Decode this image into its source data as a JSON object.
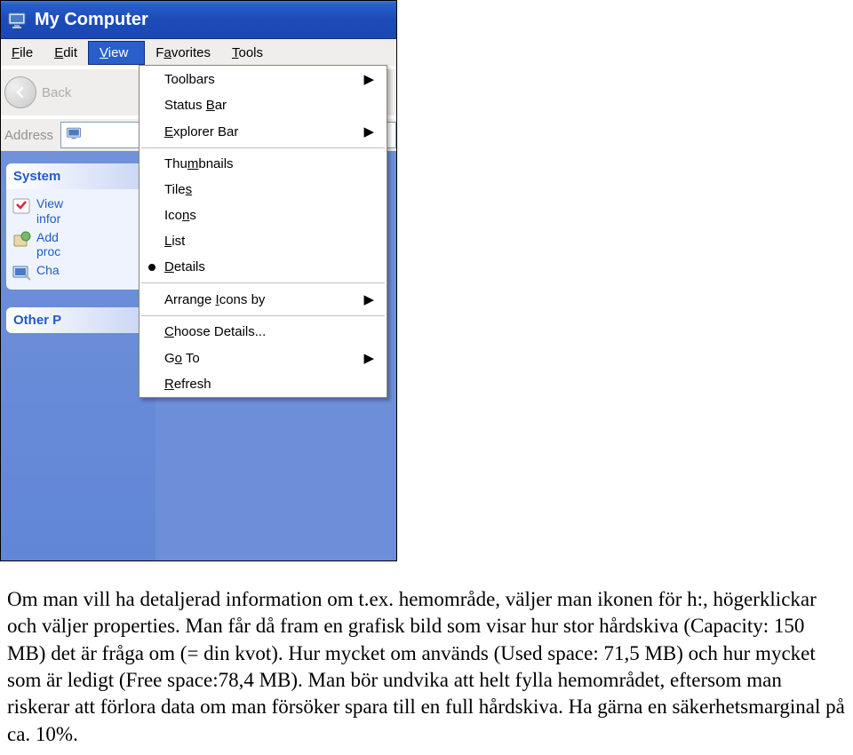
{
  "window": {
    "title": "My Computer"
  },
  "menubar": {
    "file": "File",
    "edit": "Edit",
    "view": "View",
    "favorites": "Favorites",
    "tools": "Tools"
  },
  "toolbar": {
    "back": "Back"
  },
  "address": {
    "label": "Address"
  },
  "sidebar": {
    "system_head": "System",
    "tasks": {
      "view_info": "View\ninfor",
      "add_prog": "Add\nproc",
      "change": "Cha"
    },
    "other_head": "Other P"
  },
  "dropdown": {
    "toolbars": "Toolbars",
    "status_bar_pre": "Status ",
    "status_bar_ul": "B",
    "status_bar_post": "ar",
    "explorer_pre": "",
    "explorer_ul": "E",
    "explorer_post": "xplorer Bar",
    "thumbnails_pre": "Thu",
    "thumbnails_ul": "m",
    "thumbnails_post": "bnails",
    "tiles_pre": "Tile",
    "tiles_ul": "s",
    "tiles_post": "",
    "icons_pre": "Ico",
    "icons_ul": "n",
    "icons_post": "s",
    "list_pre": "",
    "list_ul": "L",
    "list_post": "ist",
    "details_pre": "",
    "details_ul": "D",
    "details_post": "etails",
    "arrange_pre": "Arrange ",
    "arrange_ul": "I",
    "arrange_post": "cons by",
    "choose_pre": "",
    "choose_ul": "C",
    "choose_post": "hoose Details...",
    "goto_pre": "G",
    "goto_ul": "o",
    "goto_post": " To",
    "refresh_pre": "",
    "refresh_ul": "R",
    "refresh_post": "efresh"
  },
  "article": {
    "text": "Om man vill ha detaljerad information om t.ex. hemområde, väljer man ikonen för h:, högerklickar och väljer properties. Man får då fram en grafisk bild som visar hur stor hårdskiva (Capacity: 150 MB) det är fråga om (= din kvot). Hur mycket om används (Used space: 71,5 MB) och hur mycket som är ledigt (Free space:78,4 MB). Man bör undvika att helt fylla hemområdet, eftersom man riskerar att förlora data om man försöker spara till en full hårdskiva. Ha gärna en säkerhetsmarginal på ca. 10%."
  }
}
